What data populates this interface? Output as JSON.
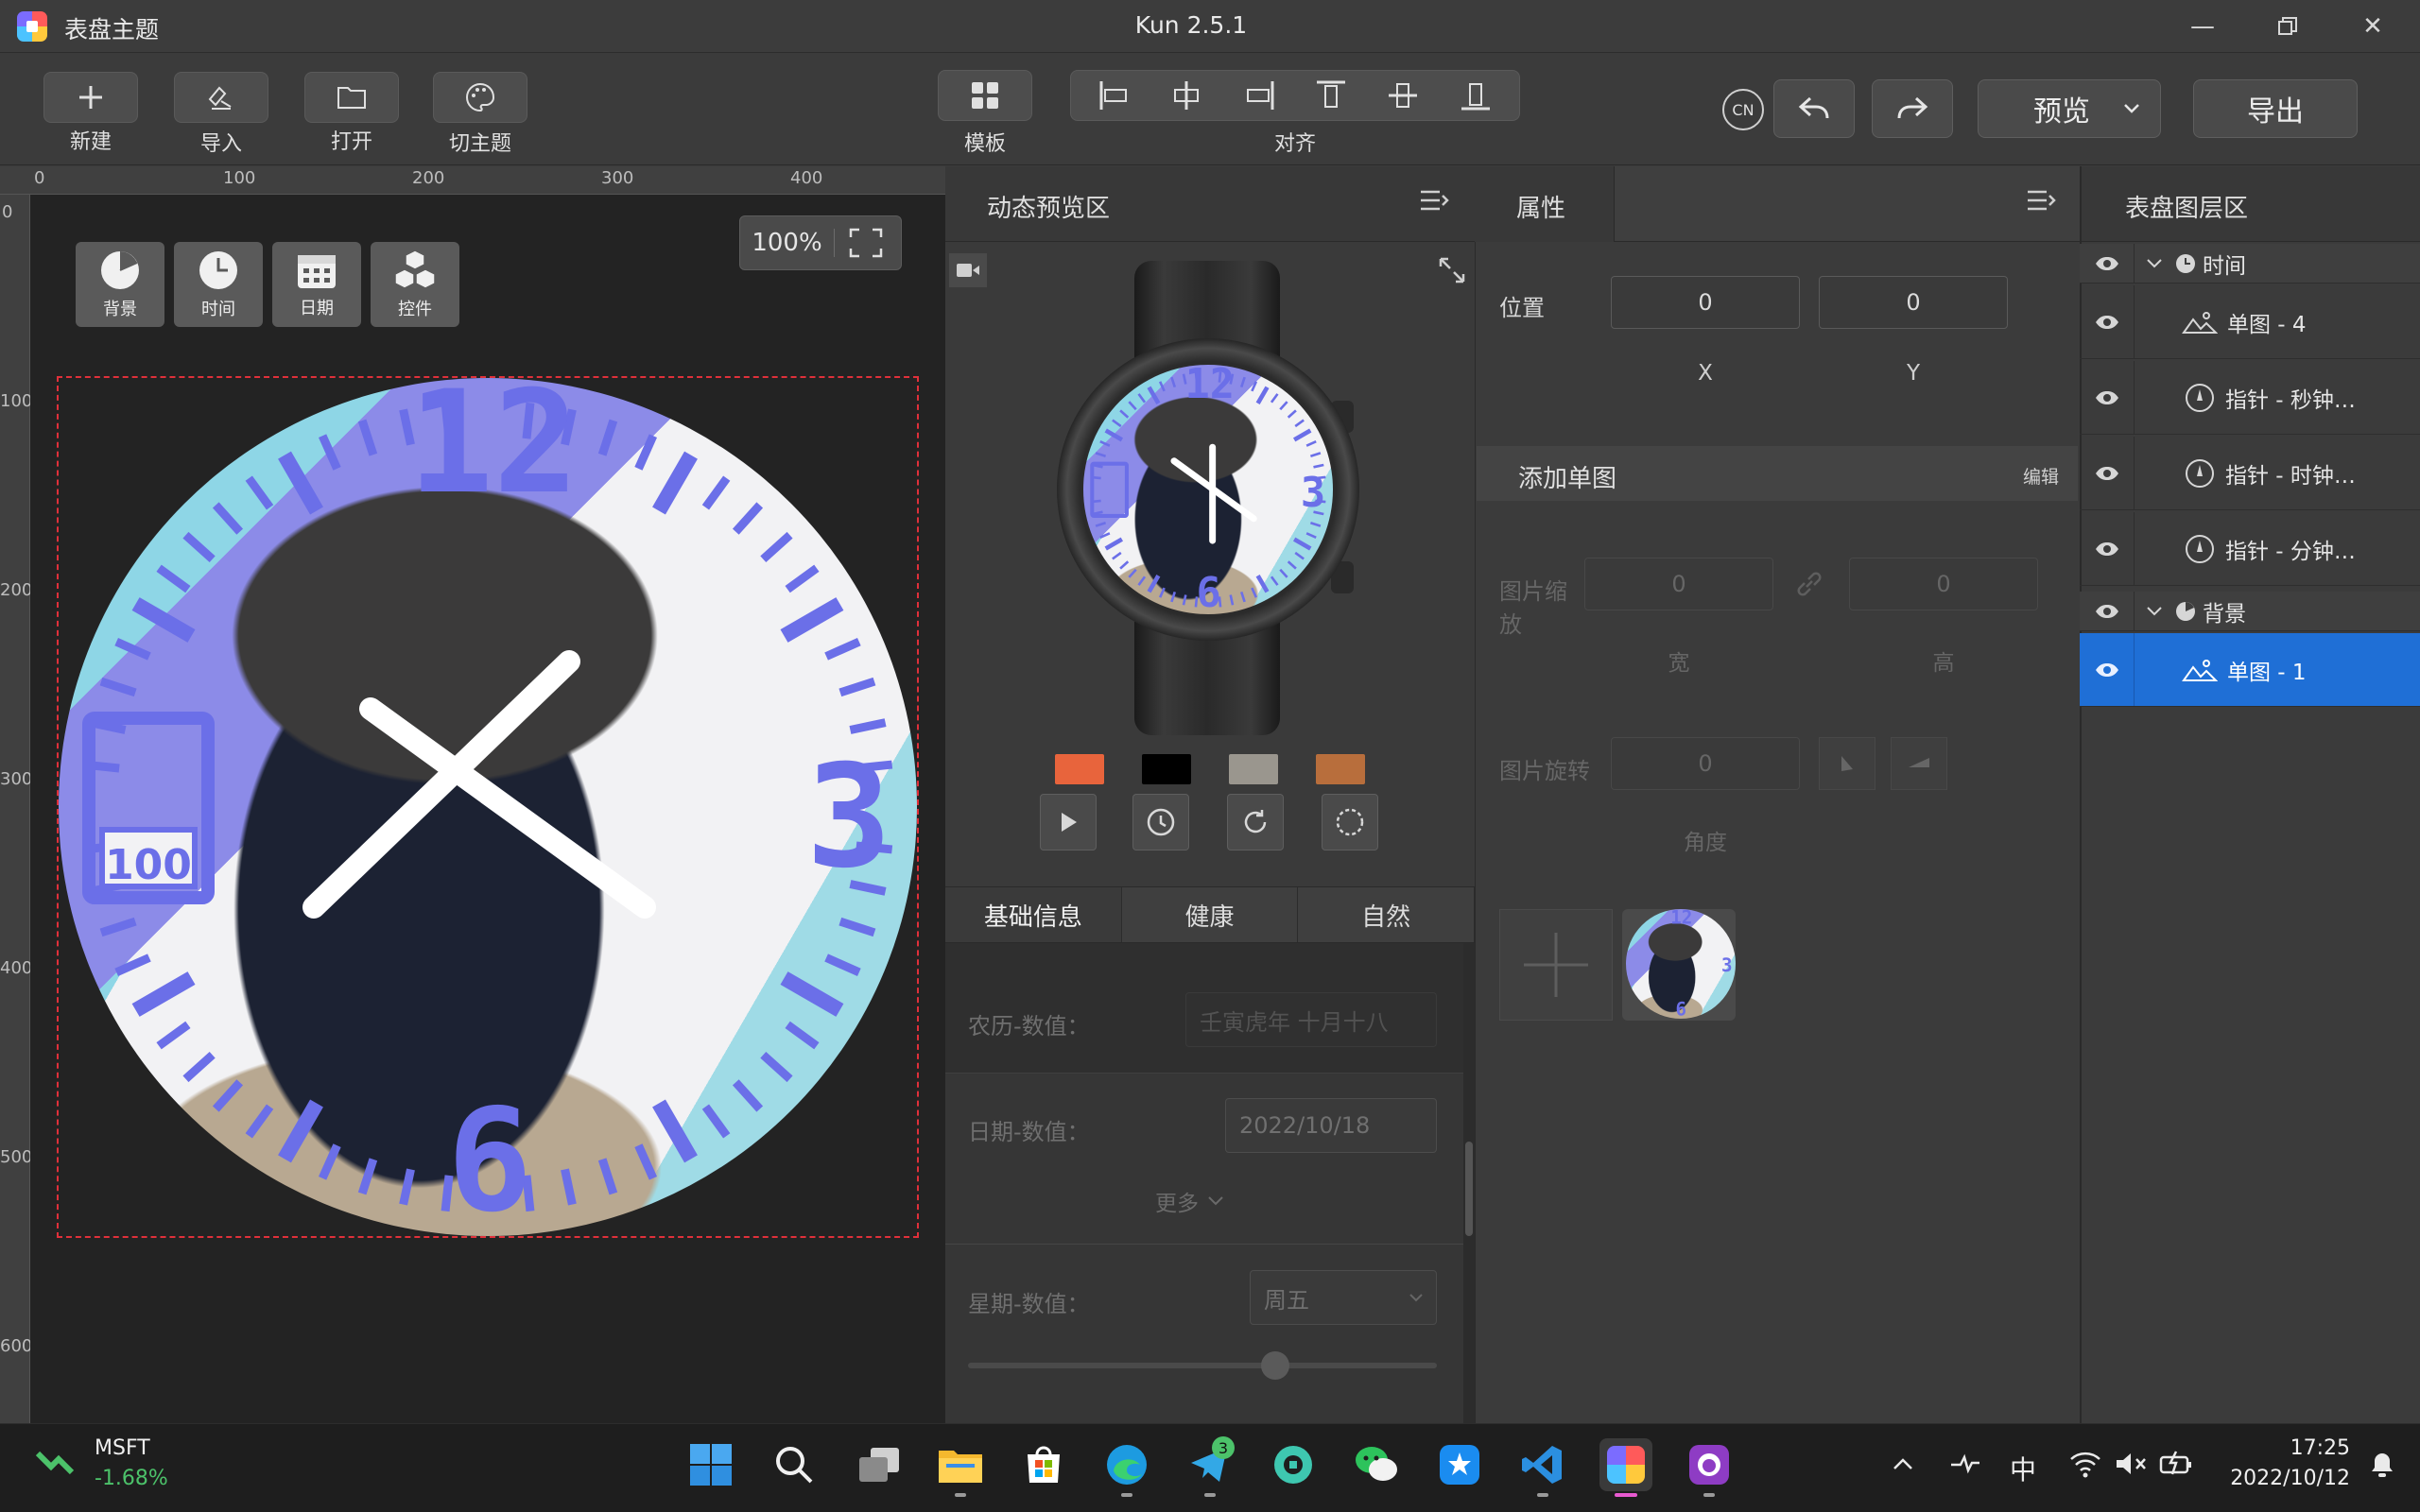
{
  "window": {
    "title": "表盘主题",
    "version": "Kun 2.5.1",
    "controls": [
      "minimize-icon",
      "restore-icon",
      "close-icon"
    ]
  },
  "toolbar": {
    "left_buttons": [
      {
        "icon": "plus-icon",
        "label": "新建"
      },
      {
        "icon": "import-icon",
        "label": "导入"
      },
      {
        "icon": "folder-icon",
        "label": "打开"
      },
      {
        "icon": "palette-icon",
        "label": "切主题"
      }
    ],
    "template_label": "模板",
    "align_label": "对齐",
    "lang_badge": "CN",
    "preview_label": "预览",
    "export_label": "导出"
  },
  "canvas": {
    "ruler_top": [
      "0",
      "100",
      "200",
      "300",
      "400"
    ],
    "ruler_left": [
      "0",
      "100",
      "200",
      "300",
      "400",
      "500",
      "600"
    ],
    "tools": [
      {
        "icon": "pie-chart-icon",
        "label": "背景"
      },
      {
        "icon": "clock-icon",
        "label": "时间"
      },
      {
        "icon": "calendar-icon",
        "label": "日期"
      },
      {
        "icon": "cubes-icon",
        "label": "控件"
      }
    ],
    "zoom": "100%",
    "face_numerals": [
      "12",
      "3",
      "6"
    ],
    "logo_text": "100"
  },
  "preview": {
    "title": "动态预览区",
    "swatches": [
      "#e8643c",
      "#000000",
      "#9a968e",
      "#b86e3c"
    ],
    "tabs": [
      "基础信息",
      "健康",
      "自然"
    ],
    "fields": [
      {
        "label": "农历-数值：",
        "value": "壬寅虎年 十月十八"
      },
      {
        "label": "日期-数值：",
        "value": "2022/10/18"
      },
      {
        "label": "星期-数值：",
        "value": "周五"
      }
    ],
    "more_label": "更多"
  },
  "properties": {
    "title": "属性",
    "position_label": "位置",
    "x_value": "0",
    "y_value": "0",
    "x_label": "X",
    "y_label": "Y",
    "add_image_label": "添加单图",
    "edit_label": "编辑",
    "scale_label_1": "图片缩",
    "scale_label_2": "放",
    "width_value": "0",
    "height_value": "0",
    "width_label": "宽",
    "height_label": "高",
    "rotate_label": "图片旋转",
    "rotate_value": "0",
    "angle_label": "角度"
  },
  "layers": {
    "title": "表盘图层区",
    "items": [
      {
        "type": "group",
        "label": "时间"
      },
      {
        "type": "item",
        "label": "单图 - 4"
      },
      {
        "type": "item",
        "label": "指针 - 秒钟…"
      },
      {
        "type": "item",
        "label": "指针 - 时钟…"
      },
      {
        "type": "item",
        "label": "指针 - 分钟…"
      },
      {
        "type": "group",
        "label": "背景"
      },
      {
        "type": "item",
        "label": "单图 - 1",
        "selected": true
      }
    ]
  },
  "taskbar": {
    "stock_name": "MSFT",
    "stock_change": "-1.68%",
    "badge_count": "3",
    "ime": "中",
    "time": "17:25",
    "date": "2022/10/12",
    "colors": {
      "accent": "#1f6fd6",
      "stock_down": "#4cc26a"
    }
  }
}
